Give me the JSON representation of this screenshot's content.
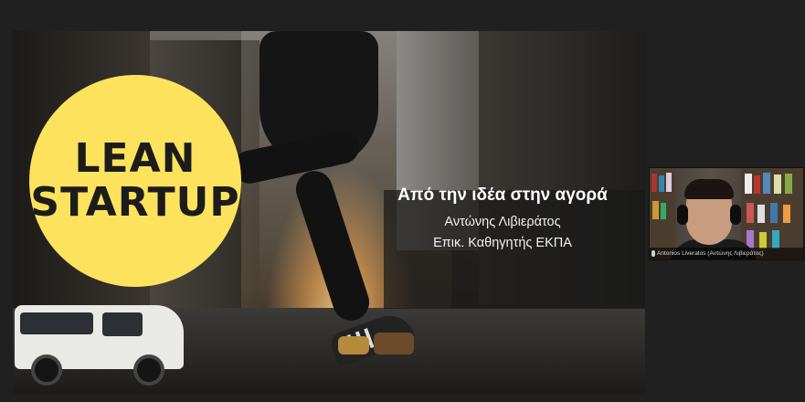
{
  "slide": {
    "badge_line1": "LEAN",
    "badge_line2": "STARTUP",
    "title": "Από την ιδέα στην αγορά",
    "presenter_name": "Αντώνης Λιβιεράτος",
    "presenter_role": "Επικ. Καθηγητής ΕΚΠΑ"
  },
  "participant": {
    "name": "Antonios Liveratos (Αντώνης Λιβιεράτος)",
    "icon": "microphone-icon"
  },
  "colors": {
    "badge": "#fde35d",
    "background": "#202020"
  }
}
